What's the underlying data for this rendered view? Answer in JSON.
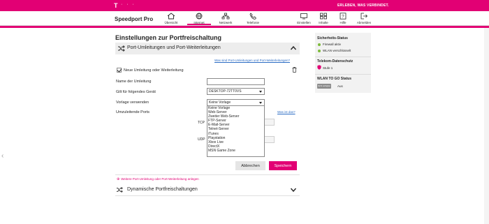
{
  "topbar": {
    "logo": "T",
    "logo_dots": "· · ·",
    "slogan": "ERLEBEN, WAS VERBINDET.",
    "color": "#e20074"
  },
  "brand": "Speedport Pro",
  "nav": {
    "main": [
      {
        "label": "Übersicht",
        "icon": "home-icon"
      },
      {
        "label": "Internet",
        "icon": "globe-icon",
        "active": true
      },
      {
        "label": "Netzwerk",
        "icon": "network-icon"
      },
      {
        "label": "Telefonie",
        "icon": "phone-icon"
      }
    ],
    "right": [
      {
        "label": "Einstellen",
        "icon": "settings-icon"
      },
      {
        "label": "Inhalte",
        "icon": "content-icon"
      },
      {
        "label": "Hilfe",
        "icon": "help-icon"
      },
      {
        "label": "Abmelden",
        "icon": "logout-icon"
      }
    ]
  },
  "page": {
    "title": "Einstellungen zur Portfreischaltung",
    "section1_title": "Port-Umleitungen und Port-Weiterleitungen",
    "help_link": "Was sind Port-Umleitungen und Port-Weiterleitungen?",
    "checkbox_label": "Neue Umleitung oder Weiterleitung",
    "checkbox_checked": true,
    "fields": {
      "name_label": "Name der Umleitung",
      "name_value": "",
      "device_label": "Gilt für folgendes Gerät",
      "device_value": "DESKTOP-72TT0VS",
      "template_label": "Vorlage verwenden",
      "template_value": "Keine Vorlage",
      "ports_label": "Umzuleitende Ports",
      "was_link": "Was ist das?",
      "tcp_label": "TCP",
      "udp_label": "UDP"
    },
    "dropdown_options": [
      "Keine Vorlage",
      "Web-Server",
      "Zweiter Web-Server",
      "FTP-Server",
      "E-Mail-Server",
      "Telnet-Server",
      "iTunes",
      "Playstation",
      "Xbox Live",
      "DirectX",
      "MSN Game Zone"
    ],
    "cancel_label": "Abbrechen",
    "save_label": "Speichern",
    "add_link": "Weitere Port-Umleitung oder Port-Weiterleitung anlegen",
    "section2_title": "Dynamische Portfreischaltungen"
  },
  "sidebar": {
    "security_title": "Sicherheits-Status",
    "firewall": "Firewall aktiv",
    "wlan": "WLAN verschlüsselt",
    "privacy_title": "Telekom-Datenschutz",
    "privacy_level": "Stufe 1",
    "wlan_to_go_title": "WLAN TO GO Status",
    "wlan_to_go_badge": "Nicht verfügbar",
    "wlan_to_go_value": "Aus",
    "status_color": "#7dbb3a"
  }
}
